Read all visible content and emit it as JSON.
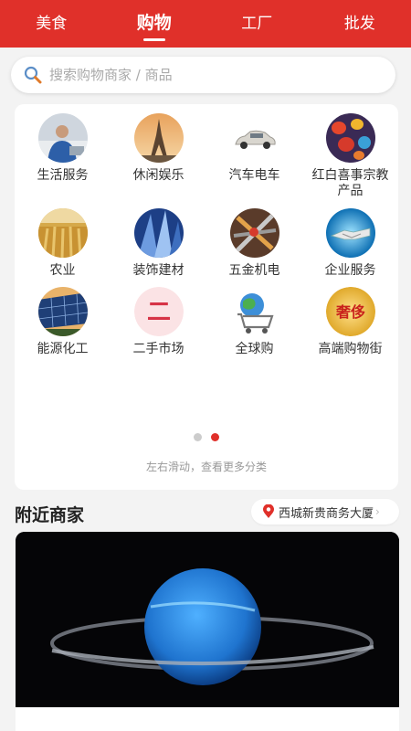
{
  "topbar": {
    "tabs": [
      {
        "label": "美食",
        "active": false
      },
      {
        "label": "购物",
        "active": true
      },
      {
        "label": "工厂",
        "active": false
      },
      {
        "label": "批发",
        "active": false
      }
    ],
    "color": "#e0302a"
  },
  "search": {
    "placeholder": "搜索购物商家 / 商品",
    "value": "",
    "icon": "search-icon"
  },
  "categories": [
    {
      "label": "生活服务",
      "icon": "life-service-icon"
    },
    {
      "label": "休闲娱乐",
      "icon": "leisure-icon"
    },
    {
      "label": "汽车电车",
      "icon": "car-icon"
    },
    {
      "label": "红白喜事宗教产品",
      "icon": "lantern-icon"
    },
    {
      "label": "农业",
      "icon": "wheat-icon"
    },
    {
      "label": "装饰建材",
      "icon": "building-icon"
    },
    {
      "label": "五金机电",
      "icon": "tools-icon"
    },
    {
      "label": "企业服务",
      "icon": "handshake-icon"
    },
    {
      "label": "能源化工",
      "icon": "solar-panel-icon"
    },
    {
      "label": "二手市场",
      "icon": "second-hand-icon",
      "glyph": "二"
    },
    {
      "label": "全球购",
      "icon": "global-cart-icon"
    },
    {
      "label": "高端购物街",
      "icon": "luxury-icon",
      "glyph": "奢侈"
    }
  ],
  "pager": {
    "total": 2,
    "active": 2
  },
  "swipe_hint": "左右滑动，查看更多分类",
  "nearby": {
    "title": "附近商家",
    "location": "西城新贵商务大厦"
  }
}
